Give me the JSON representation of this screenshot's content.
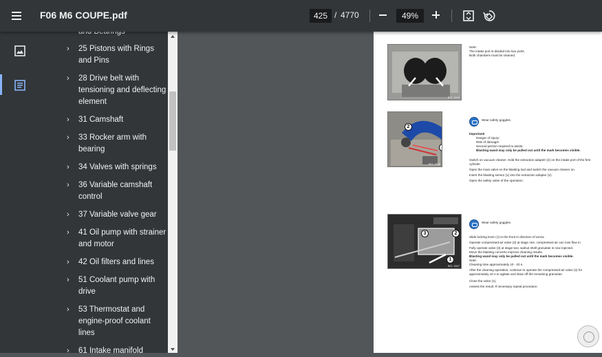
{
  "toolbar": {
    "title": "F06 M6 COUPE.pdf",
    "current_page": "425",
    "page_separator": "/",
    "total_pages": "4770",
    "zoom": "49%"
  },
  "outline": {
    "items": [
      {
        "label": "and Bearings"
      },
      {
        "label": "25 Pistons with Rings and Pins"
      },
      {
        "label": "28 Drive belt with tensioning and deflecting element"
      },
      {
        "label": "31 Camshaft"
      },
      {
        "label": "33 Rocker arm with bearing"
      },
      {
        "label": "34 Valves with springs"
      },
      {
        "label": "36 Variable camshaft control"
      },
      {
        "label": "37 Variable valve gear"
      },
      {
        "label": "41 Oil pump with strainer and motor"
      },
      {
        "label": "42 Oil filters and lines"
      },
      {
        "label": "51 Coolant pump with drive"
      },
      {
        "label": "53 Thermostat and engine-proof coolant lines"
      },
      {
        "label": "61 Intake manifold"
      }
    ]
  },
  "page": {
    "section1": {
      "note_title": "Note:",
      "line1": "The intake port is divided into two ports.",
      "line2": "Both chambers must be cleaned.",
      "photo_id": "B01 1849"
    },
    "section2": {
      "warning": "Wear safety goggles.",
      "important": "Important!",
      "bullet1": "Danger of injury!",
      "bullet2": "Risk of damage!",
      "bullet3": "Second person required to assist.",
      "bold_line": "Blasting wand may only be pulled out until the mark becomes visible.",
      "step1": "Switch on vacuum cleaner. Hold the extraction adapter (2) on the intake port of the first cylinder.",
      "step2": "Open the main valve on the blasting tool and switch the vacuum cleaner on.",
      "step3": "Insert the blasting sensor (1) into the extraction adapter (2).",
      "step4": "Open the safety valve of the operation.",
      "photo_id": "B01 1848",
      "callout1": "1",
      "callout2": "2"
    },
    "section3": {
      "warning": "Wear safety goggles.",
      "step1": "Slide locking lever (1) to the front in direction of arrow.",
      "step2": "Operate compressed-air valve (2) at stage one, compressed air can now flow in.",
      "step3": "Fully operate valve (3) at stage two; walnut shell granulate is now injected.",
      "step4": "Move the blasting concerto improve cleaning results.",
      "bold_line": "Blasting wand may only be pulled out until the mark becomes visible.",
      "note_title": "Note:",
      "note_line": "Cleaning time approximately 10 - 20 s.",
      "step5": "After the cleaning operation, continue to operate the compressed-air valve (2) for approximately 10 s to agitate and draw off the remaining granulate.",
      "step6": "Close the valve (1).",
      "step7": "Assess the result. If necessary repeat procedure.",
      "photo_id": "B01 1847",
      "callout1": "1",
      "callout2": "2",
      "callout3": "3"
    }
  },
  "icons": {
    "menu": "menu-icon",
    "fit": "fit-page-icon",
    "rotate": "rotate-icon",
    "thumbnails": "thumbnails-icon",
    "outline": "outline-icon"
  },
  "colors": {
    "toolbar": "#323639",
    "viewer_bg": "#525659",
    "accent": "#8ab4f8",
    "goggles": "#2b74c8"
  }
}
